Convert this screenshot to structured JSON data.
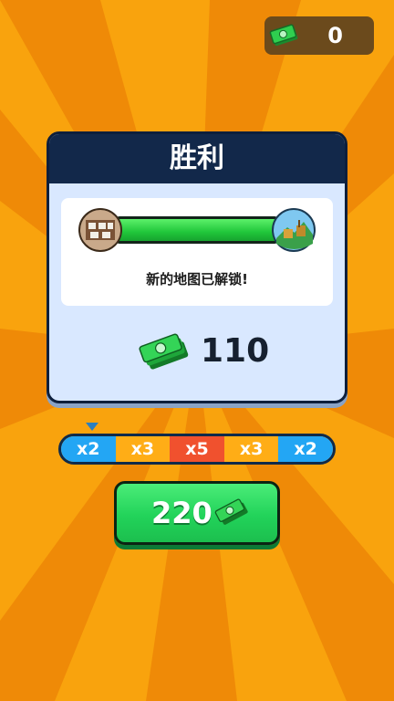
{
  "currency": {
    "value": "0",
    "icon": "cash-icon"
  },
  "panel": {
    "title": "胜利",
    "progress": {
      "fraction": 1.0,
      "from_map_icon": "map-thumbnail-icon",
      "to_map_icon": "map-thumbnail-icon"
    },
    "unlock_text": "新的地图已解锁!",
    "reward": {
      "value": "110",
      "icon": "cash-stack-icon"
    }
  },
  "multiplier_bar": {
    "segments": [
      {
        "label": "x2",
        "color": "#23a6f4"
      },
      {
        "label": "x3",
        "color": "#ffad16"
      },
      {
        "label": "x5",
        "color": "#f0512e"
      },
      {
        "label": "x3",
        "color": "#ffad16"
      },
      {
        "label": "x2",
        "color": "#23a6f4"
      }
    ],
    "pointer_icon": "triangle-pointer-icon"
  },
  "claim_button": {
    "value": "220",
    "icon": "cash-stack-icon"
  },
  "colors": {
    "background": "#f7a20c",
    "panel_header": "#12284a",
    "panel_body": "#d9e8ff",
    "button_green": "#22d35a"
  }
}
